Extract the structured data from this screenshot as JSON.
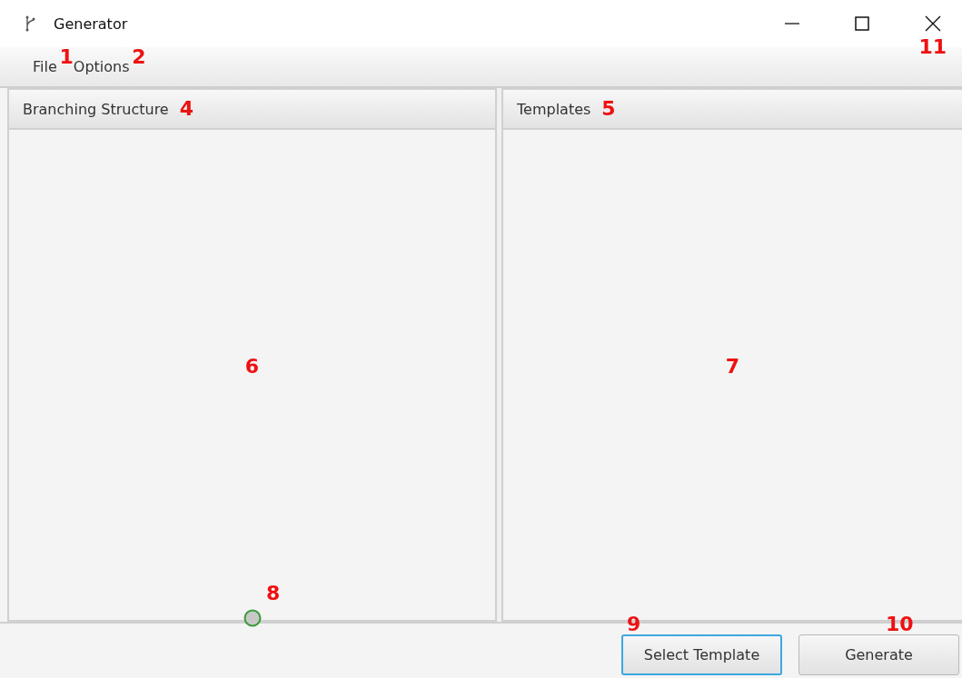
{
  "window": {
    "title": "Generator",
    "marker": "11"
  },
  "menu": [
    {
      "label": "File",
      "marker": "1"
    },
    {
      "label": "Options",
      "marker": "2"
    }
  ],
  "split": {
    "left": {
      "title": "Branching Structure",
      "header_marker": "4",
      "body_marker": "6",
      "handle_marker": "8"
    },
    "right": {
      "title": "Templates",
      "header_marker": "5",
      "body_marker": "7"
    }
  },
  "buttons": [
    {
      "label": "Select Template",
      "marker": "9",
      "focused": true
    },
    {
      "label": "Generate",
      "marker": "10",
      "focused": false
    }
  ]
}
